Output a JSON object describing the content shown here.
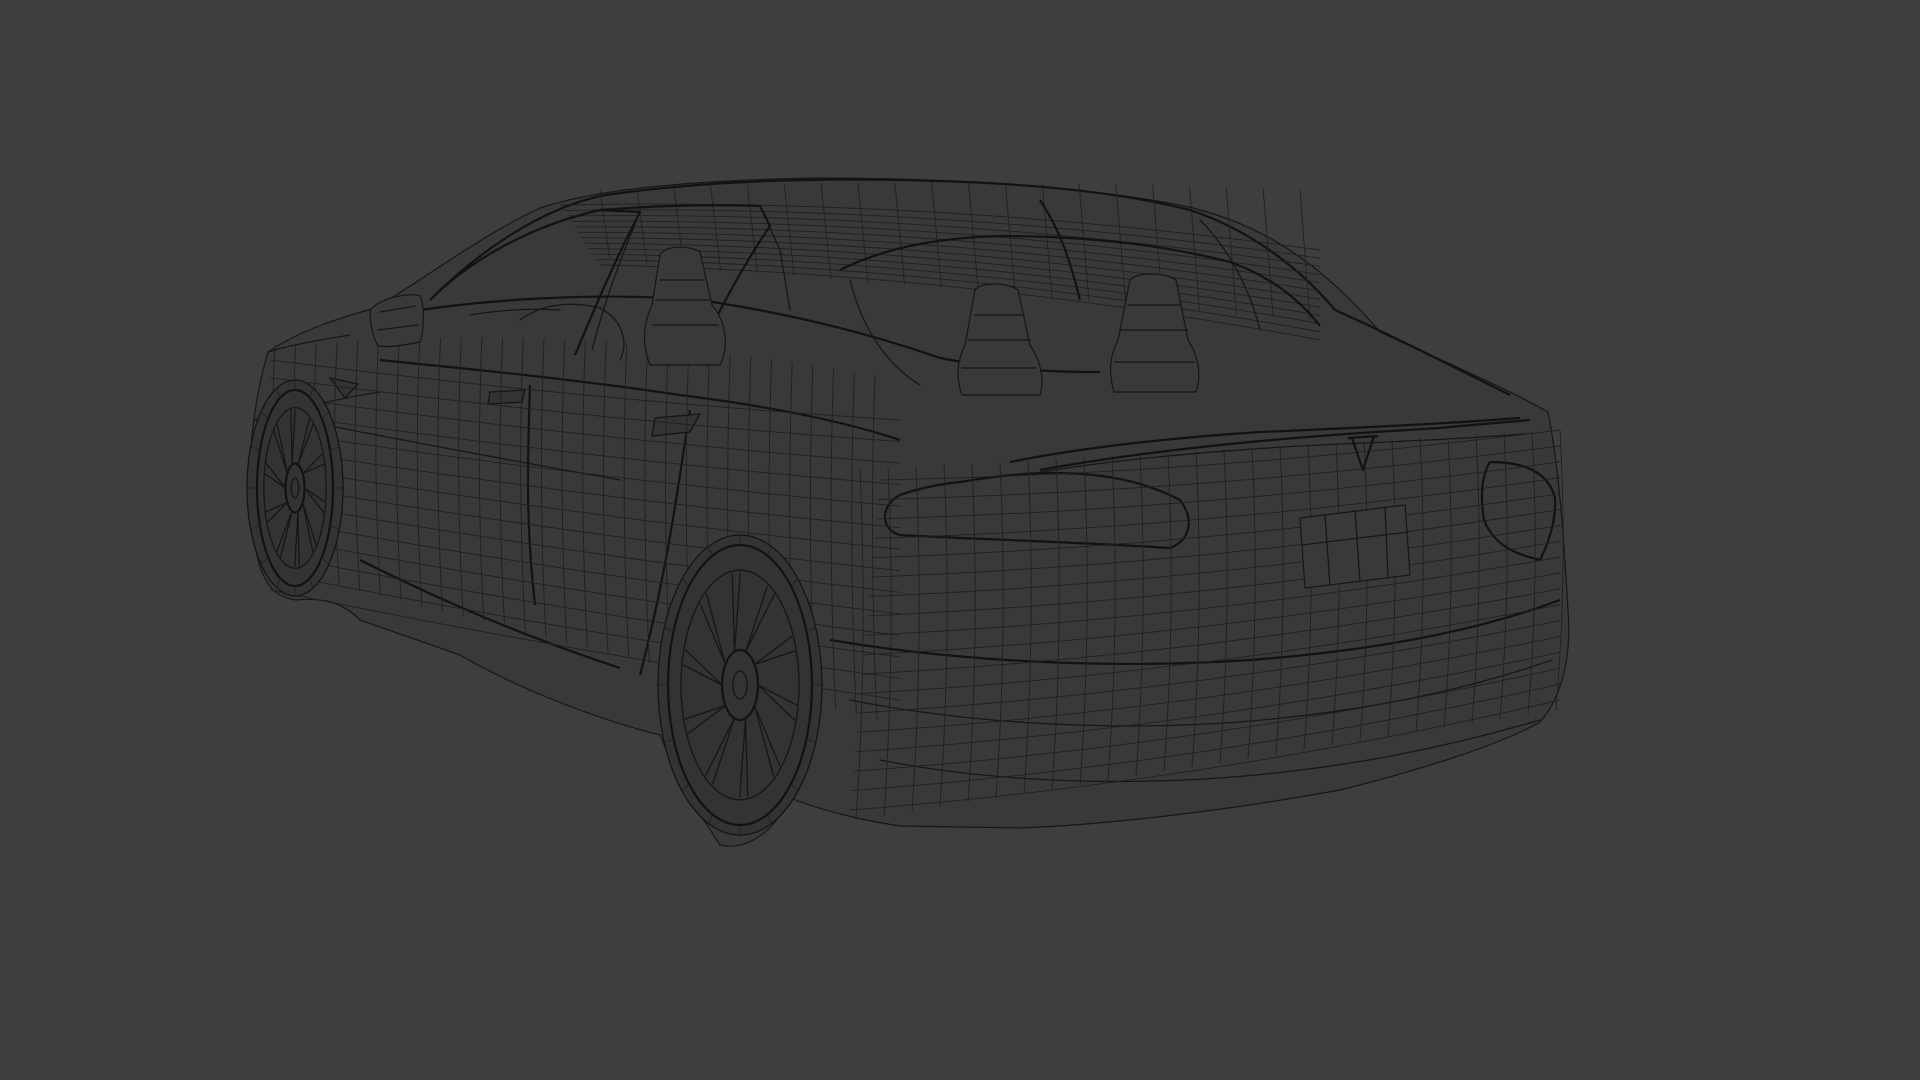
{
  "viewport": {
    "background_color": "#3e3e3e",
    "wire_color": "#161616",
    "display_mode": "wireframe"
  },
  "model": {
    "subject": "car-model",
    "parts": [
      "body",
      "front-wheel",
      "rear-wheel",
      "side-mirror",
      "front-seat",
      "rear-seats",
      "trunk-spoiler",
      "license-plate",
      "rear-logo"
    ]
  }
}
